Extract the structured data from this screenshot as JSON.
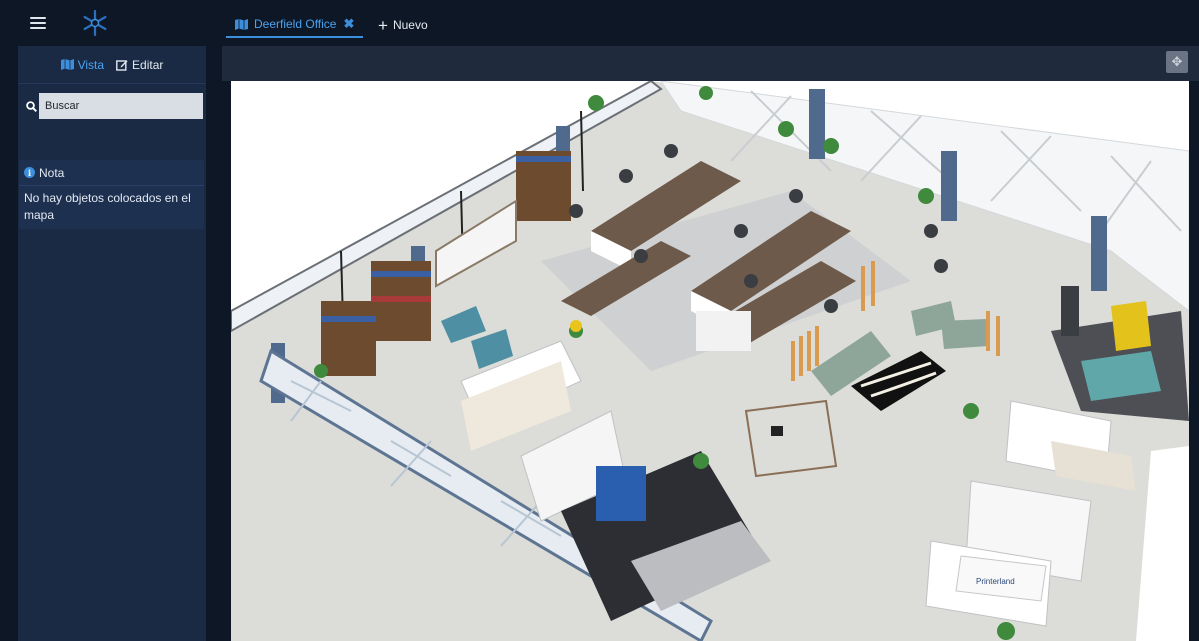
{
  "header": {
    "tabs": [
      {
        "label": "Deerfield Office",
        "active": true,
        "icon": "map-icon",
        "close": "close-icon"
      },
      {
        "label": "Nuevo",
        "icon": "plus-icon"
      }
    ]
  },
  "sidebar": {
    "tabs": [
      {
        "label": "Vista",
        "icon": "map-icon",
        "active": true
      },
      {
        "label": "Editar",
        "icon": "edit-icon",
        "active": false
      }
    ],
    "search": {
      "placeholder": "Buscar",
      "icon": "search-icon"
    },
    "note": {
      "title": "Nota",
      "icon": "info-icon",
      "message": "No hay objetos colocados en el mapa"
    }
  },
  "map": {
    "controls": {
      "move_icon": "move-icon"
    },
    "signage": {
      "company": "Printerland"
    }
  },
  "colors": {
    "background": "#0d1726",
    "sidebar": "#1a2a45",
    "accent": "#3d8fdb",
    "map_strip": "#1f2a3d"
  }
}
